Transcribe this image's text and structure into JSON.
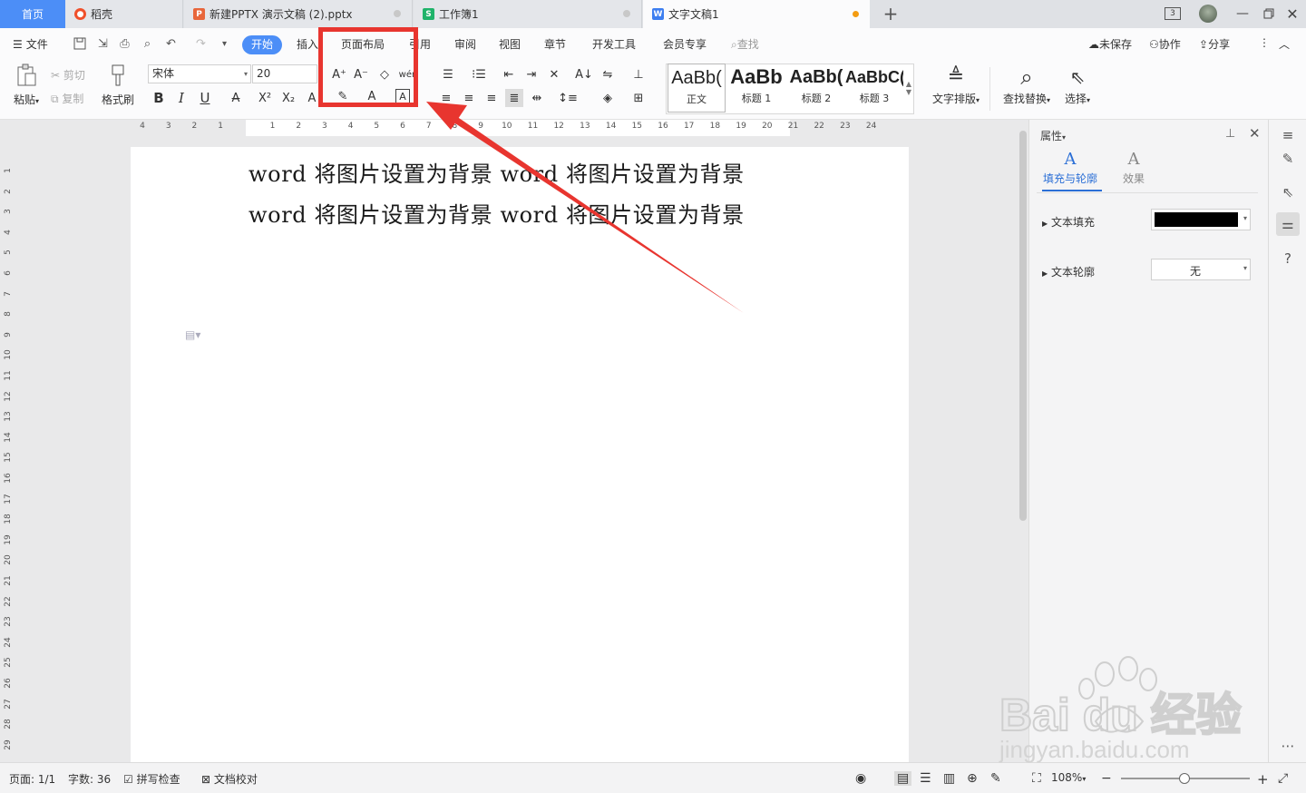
{
  "tabs": {
    "home": "首页",
    "daoke": "稻壳",
    "ppt": "新建PPTX 演示文稿 (2).pptx",
    "xls": "工作簿1",
    "doc": "文字文稿1",
    "add": "+"
  },
  "window": {
    "badge": "3"
  },
  "menu": {
    "file": "文件",
    "start": "开始",
    "insert": "插入",
    "layout": "页面布局",
    "reference": "引用",
    "review": "审阅",
    "view": "视图",
    "chapter": "章节",
    "devtools": "开发工具",
    "vip": "会员专享",
    "search": "查找",
    "unsaved": "未保存",
    "collab": "协作",
    "share": "分享"
  },
  "ribbon": {
    "paste": "粘贴",
    "cut": "剪切",
    "copy": "复制",
    "format_painter": "格式刷",
    "font_name": "宋体",
    "font_size": "20",
    "styles": [
      {
        "preview": "AaBb(",
        "label": "正文"
      },
      {
        "preview": "AaBb",
        "label": "标题 1"
      },
      {
        "preview": "AaBb(",
        "label": "标题 2"
      },
      {
        "preview": "AaBbC(",
        "label": "标题 3"
      }
    ],
    "text_layout": "文字排版",
    "find_replace": "查找替换",
    "select": "选择"
  },
  "ruler": {
    "h_ticks": [
      "4",
      "3",
      "2",
      "1",
      "",
      "1",
      "2",
      "3",
      "4",
      "5",
      "6",
      "7",
      "8",
      "9",
      "10",
      "11",
      "12",
      "13",
      "14",
      "15",
      "16",
      "17",
      "18",
      "19",
      "20",
      "21",
      "22",
      "23",
      "24"
    ],
    "v_ticks": [
      "1",
      "2",
      "3",
      "4",
      "5",
      "6",
      "7",
      "8",
      "9",
      "10",
      "11",
      "12",
      "13",
      "14",
      "15",
      "16",
      "17",
      "18",
      "19",
      "20",
      "21",
      "22",
      "23",
      "24",
      "25",
      "26",
      "27",
      "28",
      "29"
    ]
  },
  "document": {
    "lines": [
      "word 将图片设置为背景 word 将图片设置为背景",
      "word 将图片设置为背景 word 将图片设置为背景"
    ]
  },
  "panel": {
    "title": "属性",
    "tab_fill": "填充与轮廓",
    "tab_effect": "效果",
    "text_fill": "文本填充",
    "text_outline": "文本轮廓",
    "outline_value": "无",
    "fill_color": "#000000"
  },
  "status": {
    "page": "页面: 1/1",
    "words": "字数: 36",
    "spell": "拼写检查",
    "proof": "文档校对",
    "zoom": "108%"
  },
  "watermark": {
    "brand": "Bai du 经验",
    "url": "jingyan.baidu.com"
  },
  "colors": {
    "accent": "#4c8ef7",
    "annotation": "#e8352f"
  }
}
